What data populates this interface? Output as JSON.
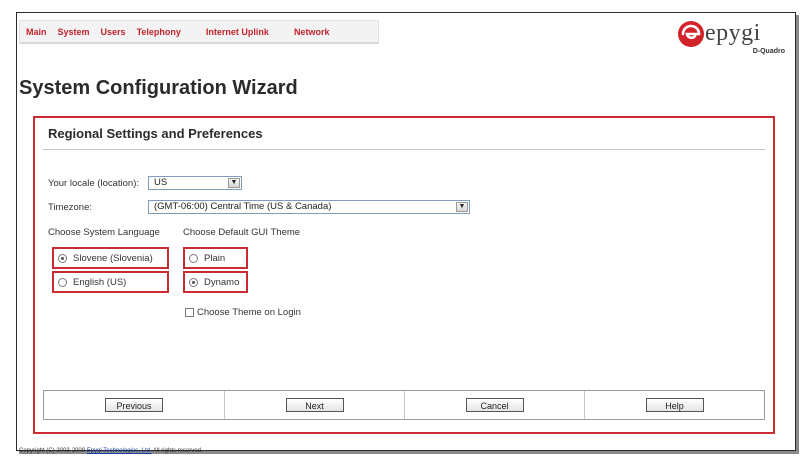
{
  "nav": {
    "items": [
      "Main",
      "System",
      "Users",
      "Telephony",
      "Internet Uplink",
      "Network"
    ]
  },
  "logo": {
    "brand": "epygi",
    "sub": "D-Quadro"
  },
  "page": {
    "title": "System Configuration Wizard"
  },
  "panel": {
    "title": "Regional Settings and Preferences",
    "locale": {
      "label": "Your locale (location):",
      "value": "US"
    },
    "timezone": {
      "label": "Timezone:",
      "value": "(GMT-06:00) Central Time (US & Canada)"
    },
    "language": {
      "label": "Choose System Language",
      "options": [
        {
          "label": "Slovene (Slovenia)",
          "checked": true
        },
        {
          "label": "English (US)",
          "checked": false
        }
      ]
    },
    "theme": {
      "label": "Choose Default GUI Theme",
      "options": [
        {
          "label": "Plain",
          "checked": false
        },
        {
          "label": "Dynamo",
          "checked": true
        }
      ],
      "login_checkbox": {
        "label": "Choose Theme on Login",
        "checked": false
      }
    }
  },
  "buttons": {
    "previous": "Previous",
    "next": "Next",
    "cancel": "Cancel",
    "help": "Help"
  },
  "footer": {
    "prefix": "Copyright (C) 2003-2009 ",
    "company": "Epygi Technologies, Ltd.",
    "suffix": " All rights reserved."
  },
  "colors": {
    "accent": "#c92b33",
    "nav_text": "#c0252f",
    "logo_red": "#d2232a"
  },
  "icons": {
    "logo_mark": "epygi-logo-icon",
    "dropdown": "chevron-down-icon"
  }
}
